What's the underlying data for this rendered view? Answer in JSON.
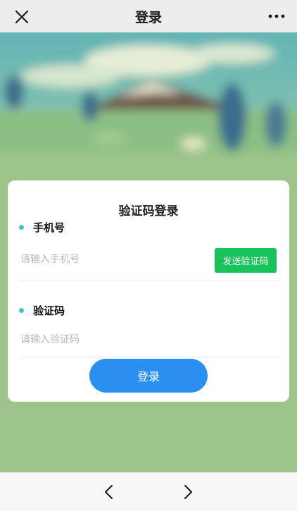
{
  "header": {
    "title": "登录",
    "close_icon": "close-icon",
    "more_icon": "more-dots-icon"
  },
  "card": {
    "title": "验证码登录",
    "phone": {
      "label": "手机号",
      "placeholder": "请输入手机号",
      "value": ""
    },
    "send_code_label": "发送验证码",
    "code": {
      "label": "验证码",
      "placeholder": "请输入验证码",
      "value": ""
    },
    "login_label": "登录"
  },
  "bottom_nav": {
    "back_icon": "chevron-left-icon",
    "forward_icon": "chevron-right-icon"
  },
  "colors": {
    "accent_blue": "#2a8ff0",
    "send_green": "#19c25a",
    "dot_teal": "#3cc8c0",
    "background_green": "#9dc48a"
  }
}
